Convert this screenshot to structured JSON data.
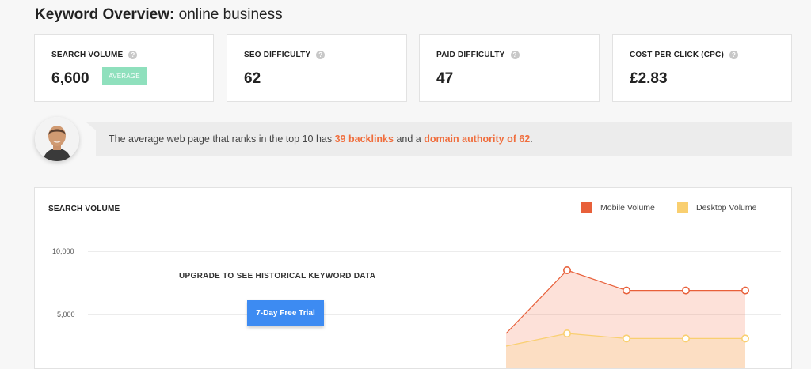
{
  "overview": {
    "title_bold": "Keyword Overview:",
    "title_keyword": "online business"
  },
  "metrics": [
    {
      "label": "SEARCH VOLUME",
      "value": "6,600",
      "badge": "AVERAGE"
    },
    {
      "label": "SEO DIFFICULTY",
      "value": "62"
    },
    {
      "label": "PAID DIFFICULTY",
      "value": "47"
    },
    {
      "label": "COST PER CLICK (CPC)",
      "value": "£2.83"
    }
  ],
  "insight": {
    "prefix": "The average web page that ranks in the top 10 has ",
    "backlinks": "39 backlinks",
    "middle": " and a ",
    "domain_authority": "domain authority of 62",
    "suffix": "."
  },
  "colors": {
    "accent": "#f06d3c",
    "badge": "#8fe0bd",
    "button": "#3d8bf2",
    "mobile": "#e8603a",
    "desktop": "#f9cf70"
  },
  "search_volume_panel": {
    "title": "SEARCH VOLUME",
    "legend_mobile": "Mobile Volume",
    "legend_desktop": "Desktop Volume",
    "upgrade_text": "UPGRADE TO SEE HISTORICAL KEYWORD DATA",
    "trial_button": "7-Day Free Trial"
  },
  "chart_data": {
    "type": "area",
    "y_ticks": [
      "10,000",
      "5,000"
    ],
    "ylim": [
      0,
      10000
    ],
    "series": [
      {
        "name": "Mobile Volume",
        "values": [
          3500,
          8500,
          6900,
          6900,
          6900
        ]
      },
      {
        "name": "Desktop Volume",
        "values": [
          2500,
          3500,
          3100,
          3100,
          3100
        ]
      }
    ]
  }
}
